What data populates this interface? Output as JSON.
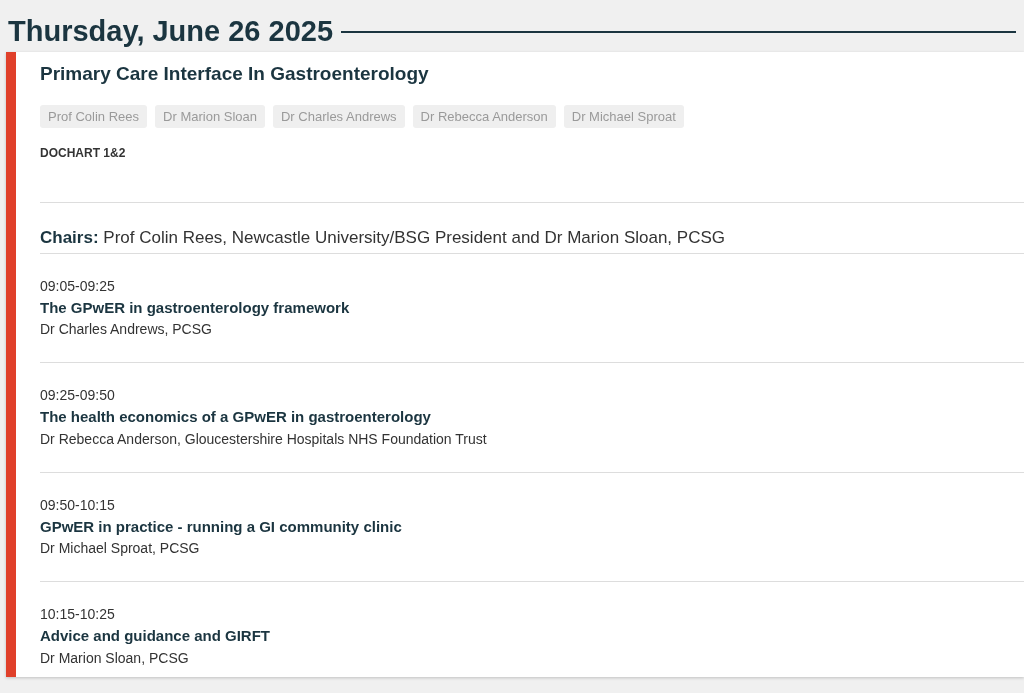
{
  "date_heading": "Thursday, June 26 2025",
  "session": {
    "title": "Primary Care Interface In Gastroenterology",
    "speaker_tags": [
      "Prof Colin Rees",
      "Dr Marion Sloan",
      "Dr Charles Andrews",
      "Dr Rebecca Anderson",
      "Dr Michael Sproat"
    ],
    "location": "DOCHART 1&2",
    "chairs": "**Chairs:** Prof Colin Rees, Newcastle University/BSG President and Dr Marion Sloan, PCSG",
    "talks": [
      {
        "time": "09:05-09:25",
        "title": "The GPwER in gastroenterology framework",
        "speaker": "Dr Charles Andrews, PCSG"
      },
      {
        "time": "09:25-09:50",
        "title": "The health economics of a GPwER in gastroenterology",
        "speaker": "Dr Rebecca Anderson, Gloucestershire Hospitals NHS Foundation Trust"
      },
      {
        "time": "09:50-10:15",
        "title": "GPwER in practice - running a GI community clinic",
        "speaker": "Dr Michael Sproat, PCSG"
      },
      {
        "time": "10:15-10:25",
        "title": "Advice and guidance and GIRFT",
        "speaker": "Dr Marion Sloan, PCSG"
      }
    ]
  }
}
